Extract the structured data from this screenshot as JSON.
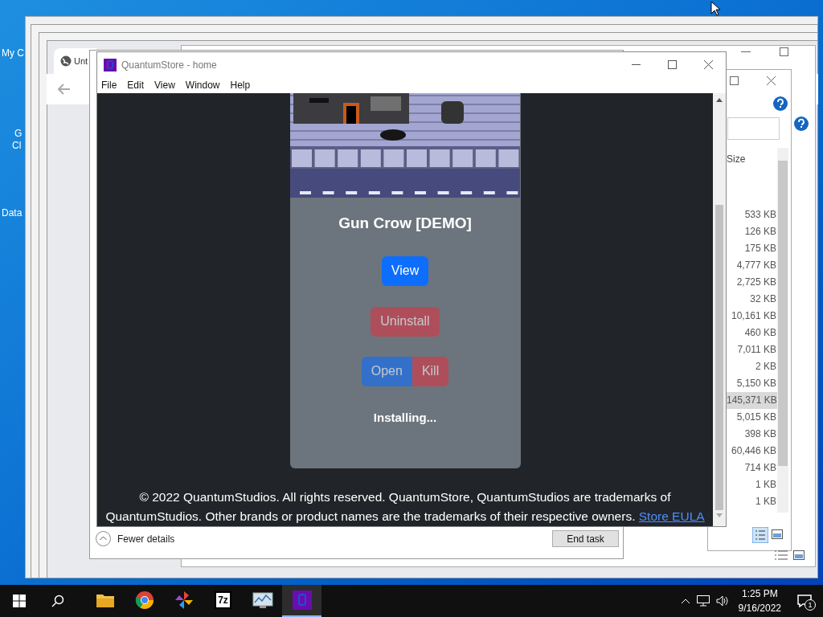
{
  "desktop": {
    "icons": [
      {
        "label": "My C"
      },
      {
        "label": "G"
      },
      {
        "label": "Cl"
      },
      {
        "label": "Data"
      }
    ]
  },
  "browser": {
    "tab": "Unt"
  },
  "explorer": {
    "column": "Size",
    "rows": [
      {
        "text": "533 KB",
        "selected": false
      },
      {
        "text": "126 KB",
        "selected": false
      },
      {
        "text": "175 KB",
        "selected": false
      },
      {
        "text": "4,777 KB",
        "selected": false
      },
      {
        "text": "2,725 KB",
        "selected": false
      },
      {
        "text": "32 KB",
        "selected": false
      },
      {
        "text": "10,161 KB",
        "selected": false
      },
      {
        "text": "460 KB",
        "selected": false
      },
      {
        "text": "7,011 KB",
        "selected": false
      },
      {
        "text": "2 KB",
        "selected": false
      },
      {
        "text": "5,150 KB",
        "selected": false
      },
      {
        "text": "145,371 KB",
        "selected": true
      },
      {
        "text": "5,015 KB",
        "selected": false
      },
      {
        "text": "398 KB",
        "selected": false
      },
      {
        "text": "60,446 KB",
        "selected": false
      },
      {
        "text": "714 KB",
        "selected": false
      },
      {
        "text": "1 KB",
        "selected": false
      },
      {
        "text": "1 KB",
        "selected": false
      }
    ]
  },
  "task_manager": {
    "toggle": "Fewer details",
    "button": "End task"
  },
  "window": {
    "title": "QuantumStore - home",
    "menu": [
      "File",
      "Edit",
      "View",
      "Window",
      "Help"
    ],
    "app": {
      "title": "Gun Crow [DEMO]",
      "buttons": [
        {
          "label": "View",
          "kind": "primary",
          "disabled": false
        },
        {
          "label": "Uninstall",
          "kind": "danger",
          "disabled": true
        }
      ],
      "pair": [
        {
          "label": "Open",
          "kind": "primary",
          "disabled": true
        },
        {
          "label": "Kill",
          "kind": "danger",
          "disabled": true
        }
      ],
      "status": "Installing...",
      "footer": {
        "text": "© 2022 QuantumStudios. All rights reserved. QuantumStore, QuantumStudios are trademarks of QuantumStudios. Other brands or product names are the trademarks of their respective owners.",
        "link": "Store EULA"
      }
    }
  },
  "taskbar": {
    "apps": [
      {
        "kind": "folder",
        "selected": false
      },
      {
        "kind": "browser",
        "selected": false
      },
      {
        "kind": "pinwheel",
        "selected": false
      },
      {
        "kind": "archiver",
        "label": "7z",
        "selected": false
      },
      {
        "kind": "monitor",
        "selected": false
      },
      {
        "kind": "store",
        "selected": true
      }
    ],
    "time": "1:25 PM",
    "date": "9/16/2022",
    "notifications": "1"
  }
}
